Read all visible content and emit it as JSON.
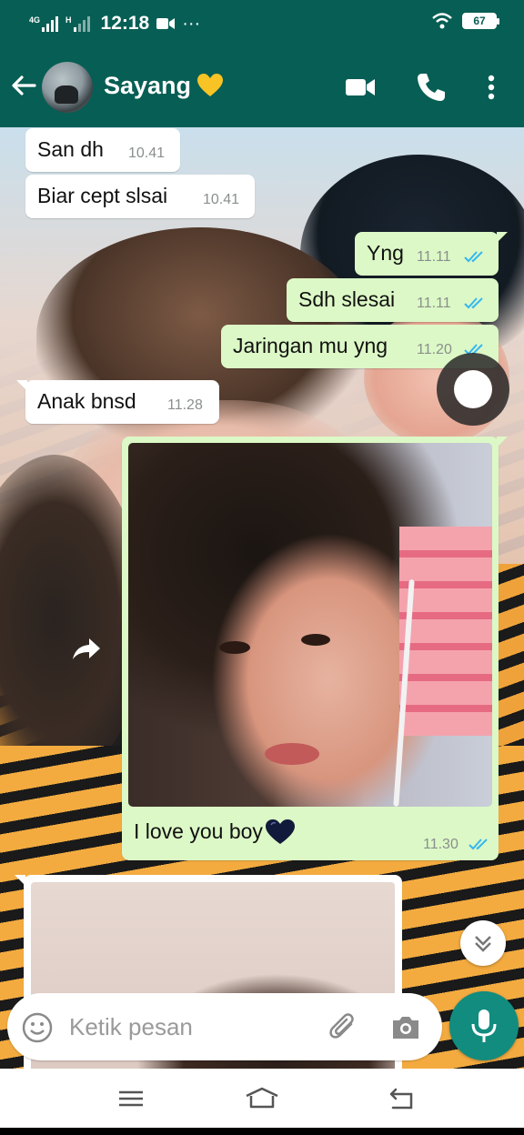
{
  "status_bar": {
    "network_label": "4G",
    "network_label2": "H",
    "time": "12:18",
    "overflow_dots": "···",
    "battery": "67"
  },
  "header": {
    "contact_name": "Sayang",
    "icons": [
      "back-arrow-icon",
      "yellow-heart-icon",
      "video-call-icon",
      "phone-icon",
      "more-vert-icon"
    ]
  },
  "messages": [
    {
      "dir": "in",
      "text": "San dh",
      "time": "10.41"
    },
    {
      "dir": "in",
      "text": "Biar cept slsai",
      "time": "10.41"
    },
    {
      "dir": "out",
      "text": "Yng",
      "time": "11.11",
      "status": "read"
    },
    {
      "dir": "out",
      "text": "Sdh slesai",
      "time": "11.11",
      "status": "read"
    },
    {
      "dir": "out",
      "text": "Jaringan mu yng",
      "time": "11.20",
      "status": "read"
    },
    {
      "dir": "in",
      "text": "Anak bnsd",
      "time": "11.28"
    }
  ],
  "image_message": {
    "caption": "I love you boy",
    "time": "11.30",
    "status": "read"
  },
  "composer": {
    "placeholder": "Ketik pesan",
    "value": ""
  },
  "colors": {
    "header": "#075e54",
    "outgoing_bubble": "#dcf8c6",
    "incoming_bubble": "#ffffff",
    "read_ticks": "#34b7f1",
    "mic_button": "#128c7e"
  }
}
